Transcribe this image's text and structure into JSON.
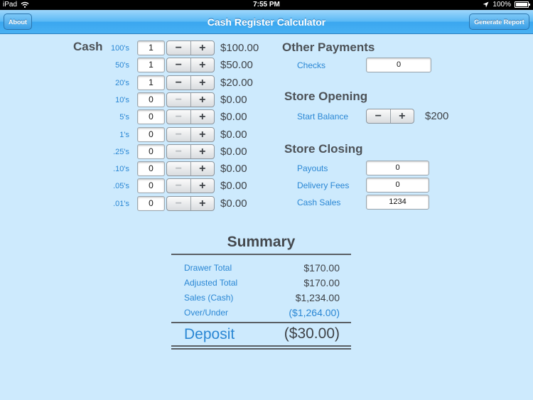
{
  "status_bar": {
    "carrier": "iPad",
    "time": "7:55 PM",
    "battery": "100%"
  },
  "nav": {
    "title": "Cash Register Calculator",
    "about_label": "About",
    "report_label": "Generate Report"
  },
  "cash": {
    "heading": "Cash",
    "rows": [
      {
        "denom": "100's",
        "qty": "1",
        "amount": "$100.00",
        "minus_enabled": true
      },
      {
        "denom": "50's",
        "qty": "1",
        "amount": "$50.00",
        "minus_enabled": true
      },
      {
        "denom": "20's",
        "qty": "1",
        "amount": "$20.00",
        "minus_enabled": true
      },
      {
        "denom": "10's",
        "qty": "0",
        "amount": "$0.00",
        "minus_enabled": false
      },
      {
        "denom": "5's",
        "qty": "0",
        "amount": "$0.00",
        "minus_enabled": false
      },
      {
        "denom": "1's",
        "qty": "0",
        "amount": "$0.00",
        "minus_enabled": false
      },
      {
        "denom": ".25's",
        "qty": "0",
        "amount": "$0.00",
        "minus_enabled": false
      },
      {
        "denom": ".10's",
        "qty": "0",
        "amount": "$0.00",
        "minus_enabled": false
      },
      {
        "denom": ".05's",
        "qty": "0",
        "amount": "$0.00",
        "minus_enabled": false
      },
      {
        "denom": ".01's",
        "qty": "0",
        "amount": "$0.00",
        "minus_enabled": false
      }
    ],
    "minus_symbol": "−",
    "plus_symbol": "+"
  },
  "other_payments": {
    "heading": "Other Payments",
    "checks_label": "Checks",
    "checks_value": "0"
  },
  "store_opening": {
    "heading": "Store Opening",
    "start_balance_label": "Start Balance",
    "start_balance_value": "$200"
  },
  "store_closing": {
    "heading": "Store Closing",
    "payouts_label": "Payouts",
    "payouts_value": "0",
    "delivery_label": "Delivery Fees",
    "delivery_value": "0",
    "cash_sales_label": "Cash Sales",
    "cash_sales_value": "1234"
  },
  "summary": {
    "title": "Summary",
    "drawer_total_label": "Drawer Total",
    "drawer_total_value": "$170.00",
    "adjusted_total_label": "Adjusted Total",
    "adjusted_total_value": "$170.00",
    "sales_label": "Sales (Cash)",
    "sales_value": "$1,234.00",
    "over_under_label": "Over/Under",
    "over_under_value": "($1,264.00)",
    "deposit_label": "Deposit",
    "deposit_value": "($30.00)"
  },
  "colors": {
    "background": "#cdeafd",
    "accent_blue": "#2a87d4",
    "nav_blue": "#48b1f3"
  },
  "icons": {
    "wifi": "wifi-icon",
    "location": "location-arrow-icon",
    "battery": "battery-icon"
  }
}
